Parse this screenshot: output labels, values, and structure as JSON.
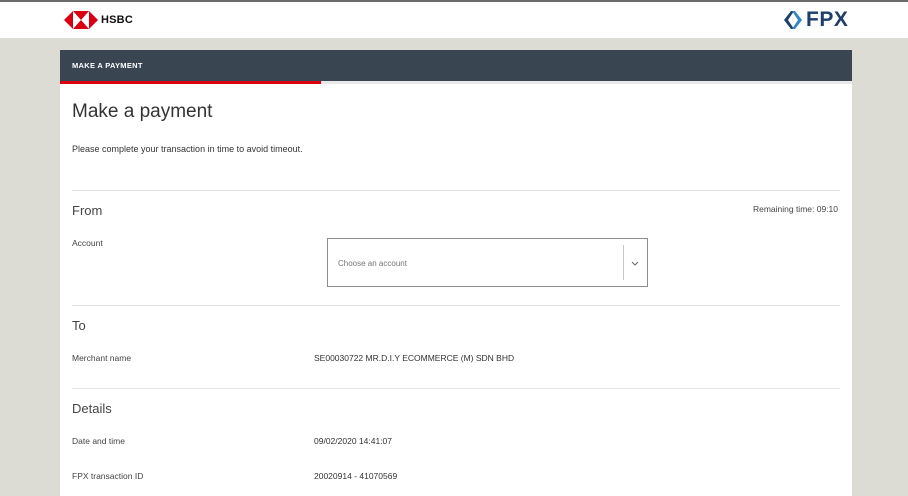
{
  "header": {
    "bank_name": "HSBC",
    "gateway_name": "FPX",
    "colors": {
      "hsbc_red": "#db0011",
      "fpx_blue": "#1c3f6b"
    }
  },
  "card": {
    "header_title": "MAKE A PAYMENT",
    "progress_percent": 33,
    "page_title": "Make a payment",
    "intro_text": "Please complete your transaction in time to avoid timeout."
  },
  "from": {
    "section_title": "From",
    "remaining_time": "Remaining time: 09:10",
    "account_label": "Account",
    "account_placeholder": "Choose an account"
  },
  "to": {
    "section_title": "To",
    "merchant_label": "Merchant name",
    "merchant_value": "SE00030722 MR.D.I.Y ECOMMERCE (M) SDN BHD"
  },
  "details": {
    "section_title": "Details",
    "datetime_label": "Date and time",
    "datetime_value": "09/02/2020 14:41:07",
    "txn_label": "FPX transaction ID",
    "txn_value": "20020914 - 41070569"
  },
  "icons": [
    "hsbc-hexagon-icon",
    "fpx-mark-icon",
    "chevron-down-icon"
  ]
}
